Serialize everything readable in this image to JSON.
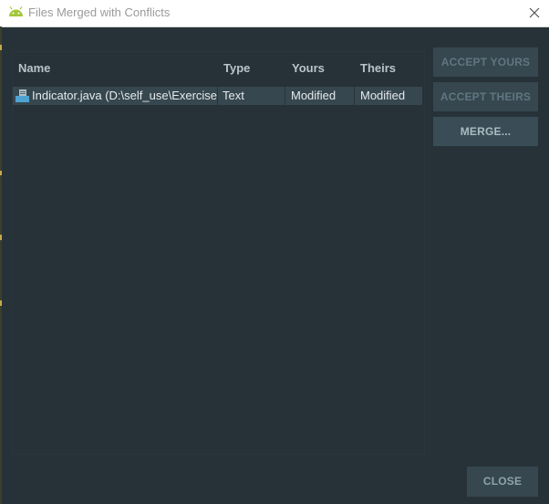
{
  "window": {
    "title": "Files Merged with Conflicts",
    "app_icon": "android-icon",
    "close_icon": "close-icon"
  },
  "table": {
    "columns": [
      "Name",
      "Type",
      "Yours",
      "Theirs"
    ],
    "rows": [
      {
        "icon": "java-file-icon",
        "name": "Indicator.java (D:\\self_use\\Exercise(",
        "type": "Text",
        "yours": "Modified",
        "theirs": "Modified"
      }
    ]
  },
  "actions": {
    "accept_yours": "ACCEPT YOURS",
    "accept_theirs": "ACCEPT THEIRS",
    "merge": "MERGE...",
    "close": "CLOSE"
  },
  "colors": {
    "background": "#263238",
    "row_selected": "#37474f",
    "android_green": "#a4c639",
    "file_icon_blue": "#4fa3d1"
  }
}
